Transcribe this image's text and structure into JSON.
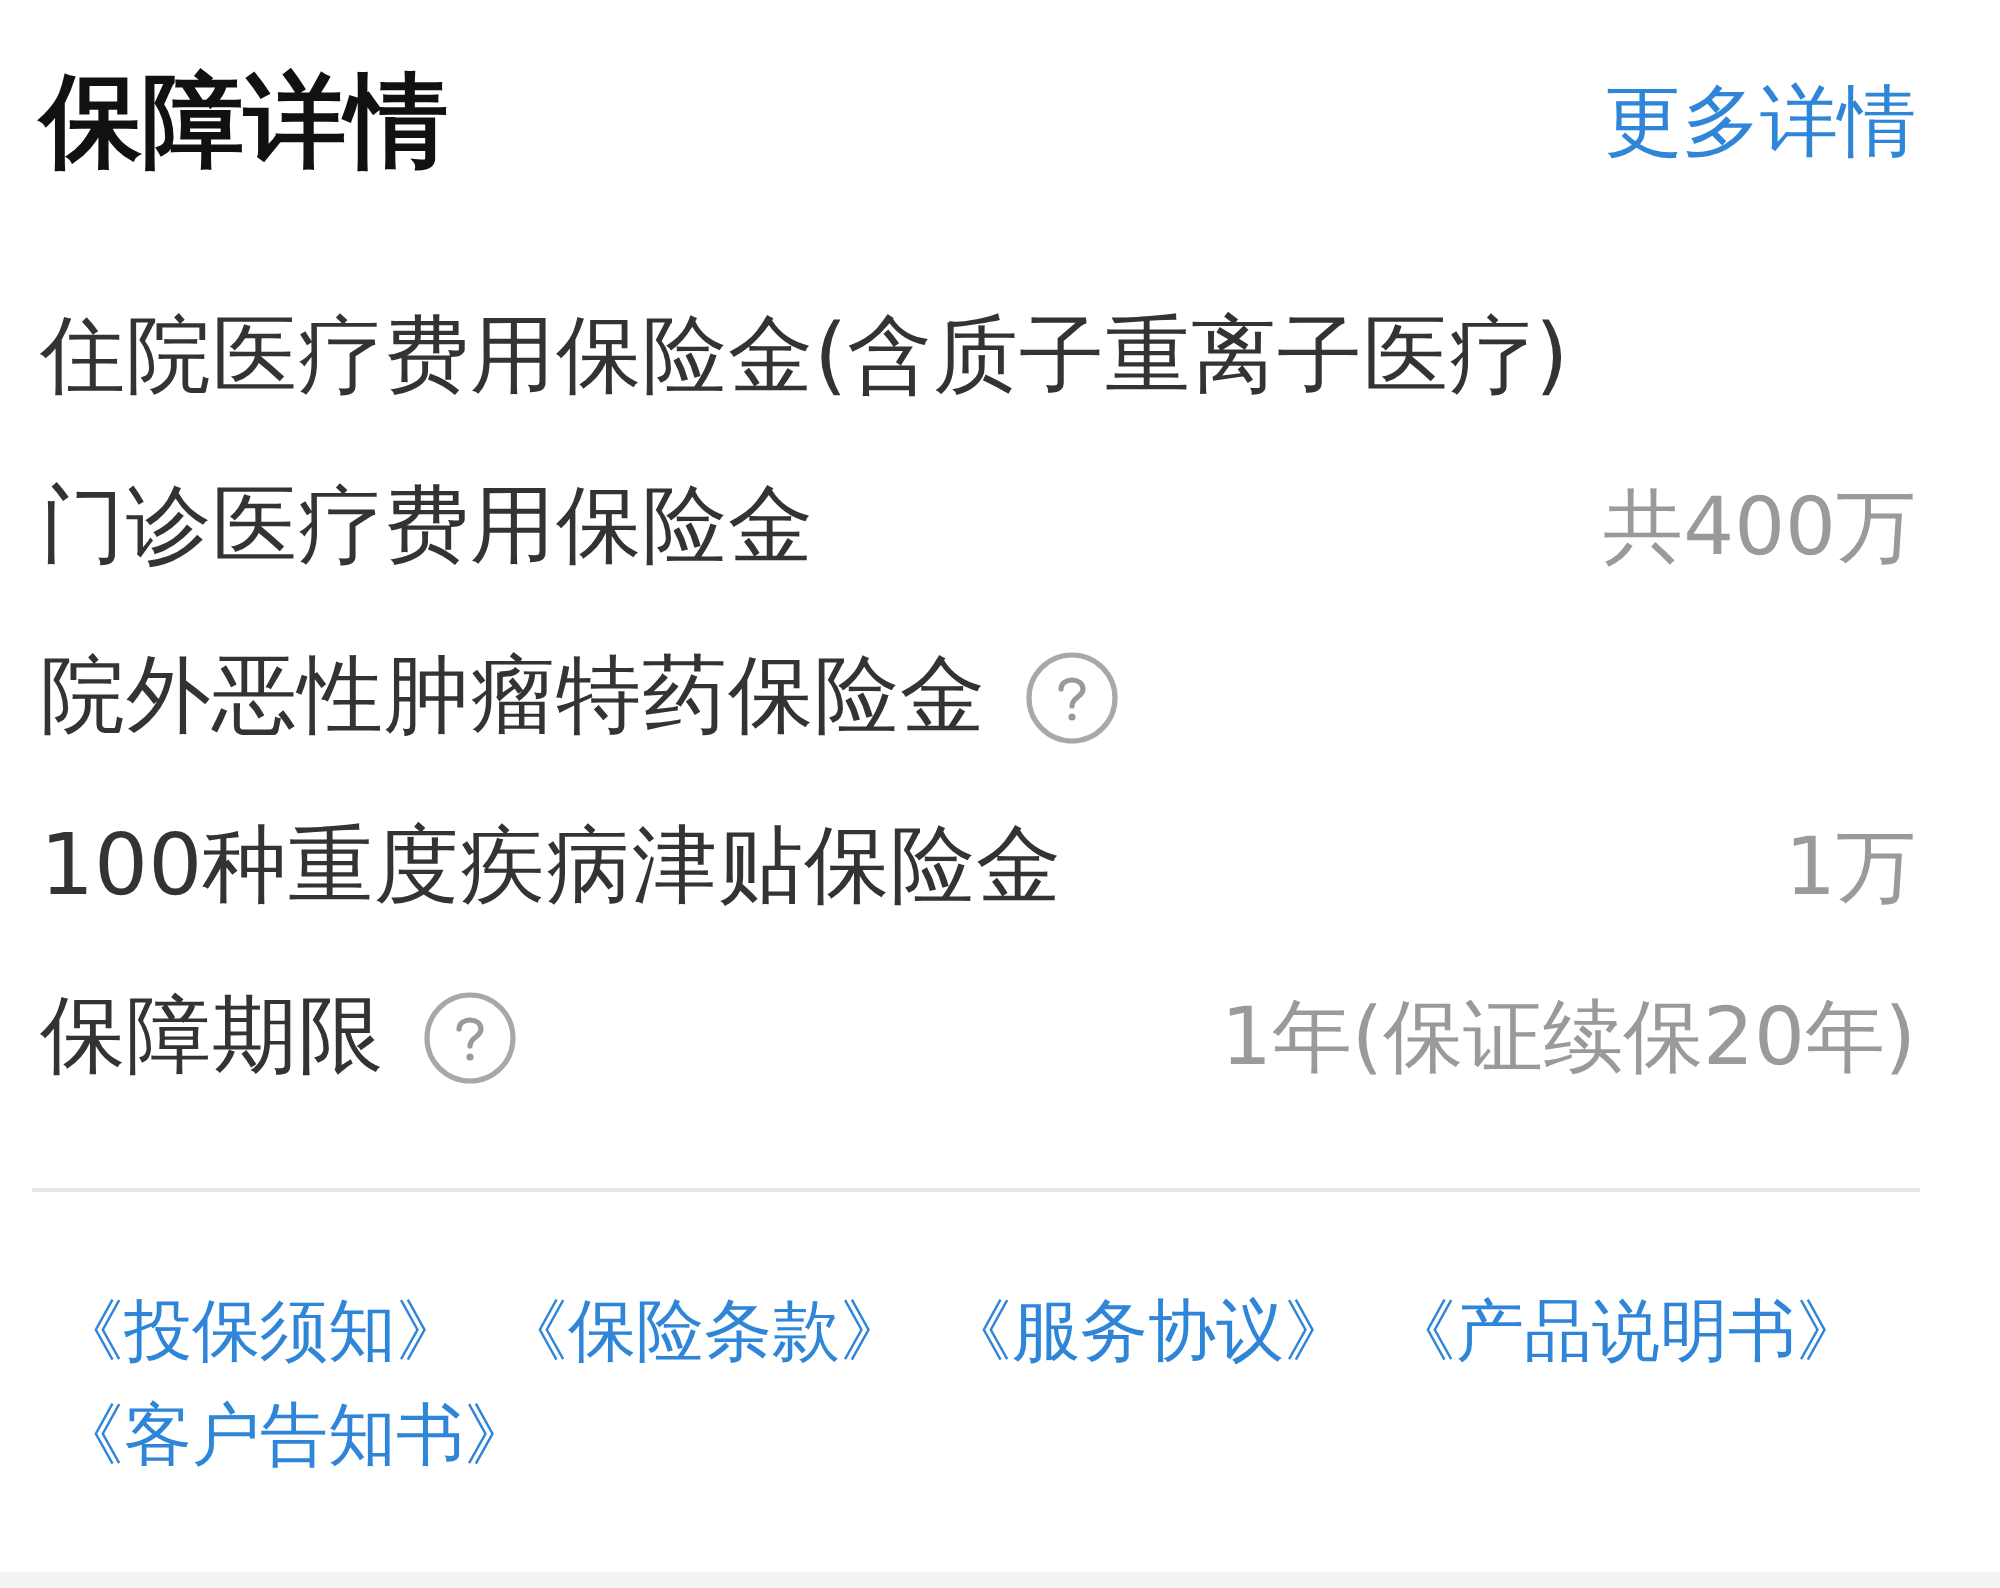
{
  "header": {
    "title": "保障详情",
    "more_link": "更多详情"
  },
  "items": [
    {
      "label": "住院医疗费用保险金(含质子重离子医疗)",
      "help": false
    },
    {
      "label": "门诊医疗费用保险金",
      "value": "共400万",
      "help": false
    },
    {
      "label": "院外恶性肿瘤特药保险金",
      "help": true
    },
    {
      "label": "100种重度疾病津贴保险金",
      "value": "1万",
      "help": false
    },
    {
      "label": "保障期限",
      "value": "1年(保证续保20年)",
      "help": true
    }
  ],
  "documents": [
    "《投保须知》",
    "《保险条款》",
    "《服务协议》",
    "《产品说明书》",
    "《客户告知书》"
  ]
}
